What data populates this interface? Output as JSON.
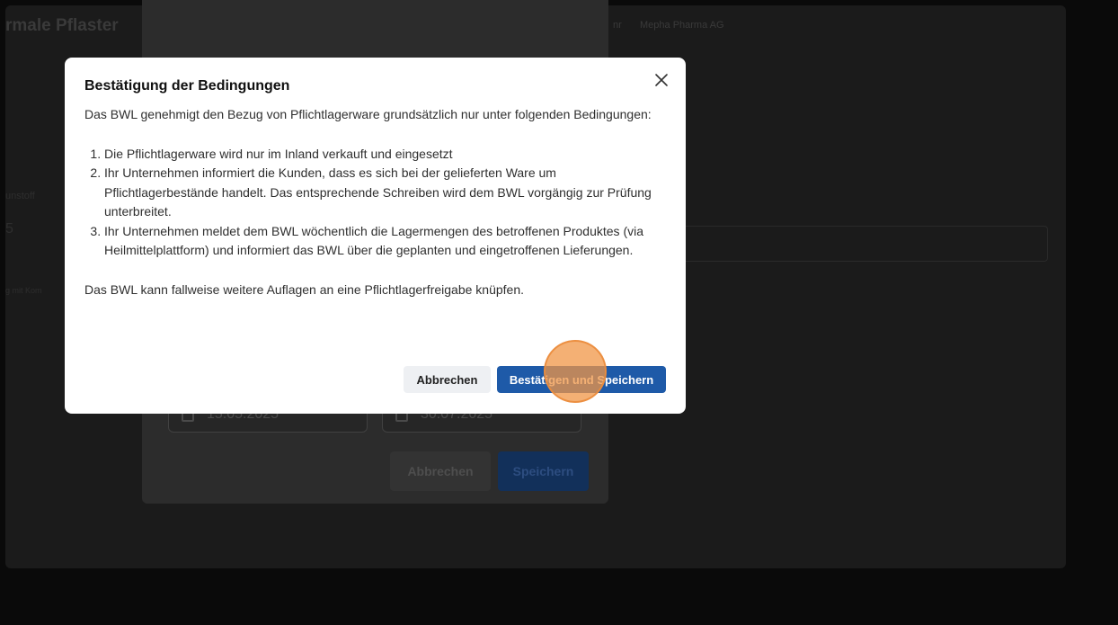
{
  "background_page": {
    "title": "rmale Pflaster",
    "separator": "nr",
    "company": "Mepha Pharma AG",
    "left_label": "unstoff",
    "left_value": "5",
    "left_link": "g mit Kom"
  },
  "underlying_modal": {
    "date_from": "15.05.2025",
    "date_to": "30.07.2025",
    "cancel_label": "Abbrechen",
    "save_label": "Speichern"
  },
  "dialog": {
    "title": "Bestätigung der Bedingungen",
    "intro": "Das BWL genehmigt den Bezug von Pflichtlagerware grundsätzlich nur unter folgenden Bedingungen:",
    "conditions": [
      "Die Pflichtlagerware wird nur im Inland verkauft und eingesetzt",
      "Ihr Unternehmen informiert die Kunden, dass es sich bei der gelieferten Ware um Pflichtlagerbestände handelt. Das entsprechende Schreiben wird dem BWL vorgängig zur Prüfung unterbreitet.",
      "Ihr Unternehmen meldet dem BWL wöchentlich die Lagermengen des betroffenen Produktes (via Heilmittelplattform) und informiert das BWL über die geplanten und eingetroffenen Lieferungen."
    ],
    "footnote": "Das BWL kann fallweise weitere Auflagen an eine Pflichtlagerfreigabe knüpfen.",
    "cancel_label": "Abbrechen",
    "confirm_label": "Bestätigen und Speichern",
    "close_icon": "close-icon"
  },
  "colors": {
    "primary": "#1e5aa8",
    "overlay": "#0a0a0a",
    "click_indicator": "#f0964a"
  }
}
